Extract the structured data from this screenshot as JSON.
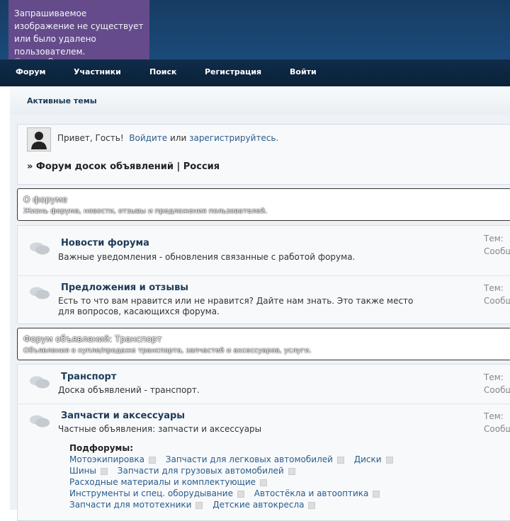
{
  "missing_image": {
    "message": "Запрашиваемое изображение не существует или было удалено пользователем.",
    "copyright": "© yapx.Ru"
  },
  "nav": [
    "Форум",
    "Участники",
    "Поиск",
    "Регистрация",
    "Войти"
  ],
  "subbar": {
    "active_topics": "Активные темы"
  },
  "greeting": {
    "hello": "Привет, Гость!",
    "login": "Войдите",
    "or": "или",
    "register": "зарегистрируйтесь.",
    "breadcrumb": "» Форум досок объявлений | Россия"
  },
  "categories": [
    {
      "title": "О форуме",
      "desc": "Жизнь форума, новости, отзывы и предложения пользователей.",
      "forums": [
        {
          "title": "Новости форума",
          "desc": "Важные уведомления - обновления связанные с работой форума.",
          "stat1": "Тем:",
          "stat2": "Сообщ"
        },
        {
          "title": "Предложения и отзывы",
          "desc": "Есть то что вам нравится или не нравится? Дайте нам знать. Это также место для вопросов, касающихся форума.",
          "stat1": "Тем:",
          "stat2": "Сообщ"
        }
      ]
    },
    {
      "title": "Форум объявлений: Транспорт",
      "desc": "Объявления о купле/продаже транспорта, запчастей и аксессуаров, услуги.",
      "forums": [
        {
          "title": "Транспорт",
          "desc": "Доска объявлений - транспорт.",
          "stat1": "Тем:",
          "stat2": "Сообщ"
        },
        {
          "title": "Запчасти и аксессуары",
          "desc": "Частные объявления: запчасти и аксессуары",
          "stat1": "Тем:",
          "stat2": "Сообщ"
        }
      ]
    }
  ],
  "subforums": {
    "heading": "Подфорумы:",
    "items": [
      "Мотоэкипировка",
      "Запчасти для легковых автомобилей",
      "Диски",
      "Шины",
      "Запчасти для грузовых автомобилей",
      "Расходные материалы и комплектующие",
      "Инструменты и спец. оборудывание",
      "Автостёкла и автооптика",
      "Запчасти для мототехники",
      "Детские автокресла"
    ]
  }
}
